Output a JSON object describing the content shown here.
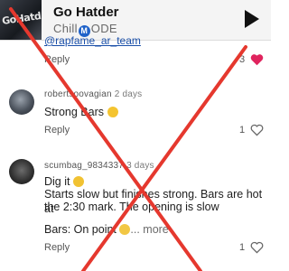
{
  "player": {
    "cover_text": "GoHatd",
    "title": "Go Hatder",
    "subtitle_pre": "Chill",
    "subtitle_mid": "M",
    "subtitle_post": "ODE"
  },
  "comments": [
    {
      "text": "@rapfame_ar_team",
      "reply_label": "Reply",
      "like_count": "3"
    },
    {
      "username": "robertsoovagian",
      "age": "2 days",
      "text": "Strong Bars",
      "emoji": "flexed-biceps",
      "reply_label": "Reply",
      "like_count": "1"
    },
    {
      "username": "scumbag_9834337",
      "age": "3 days",
      "line1": "Dig it",
      "line2": "Starts slow but finishes strong. Bars are hot at",
      "line3": "the 2:30 mark. The opening is slow",
      "line4": "Bars: On point",
      "more": "... more",
      "reply_label": "Reply",
      "like_count": "1"
    }
  ],
  "colors": {
    "overlay_red": "#e5382e",
    "liked_heart": "#e0245e"
  }
}
